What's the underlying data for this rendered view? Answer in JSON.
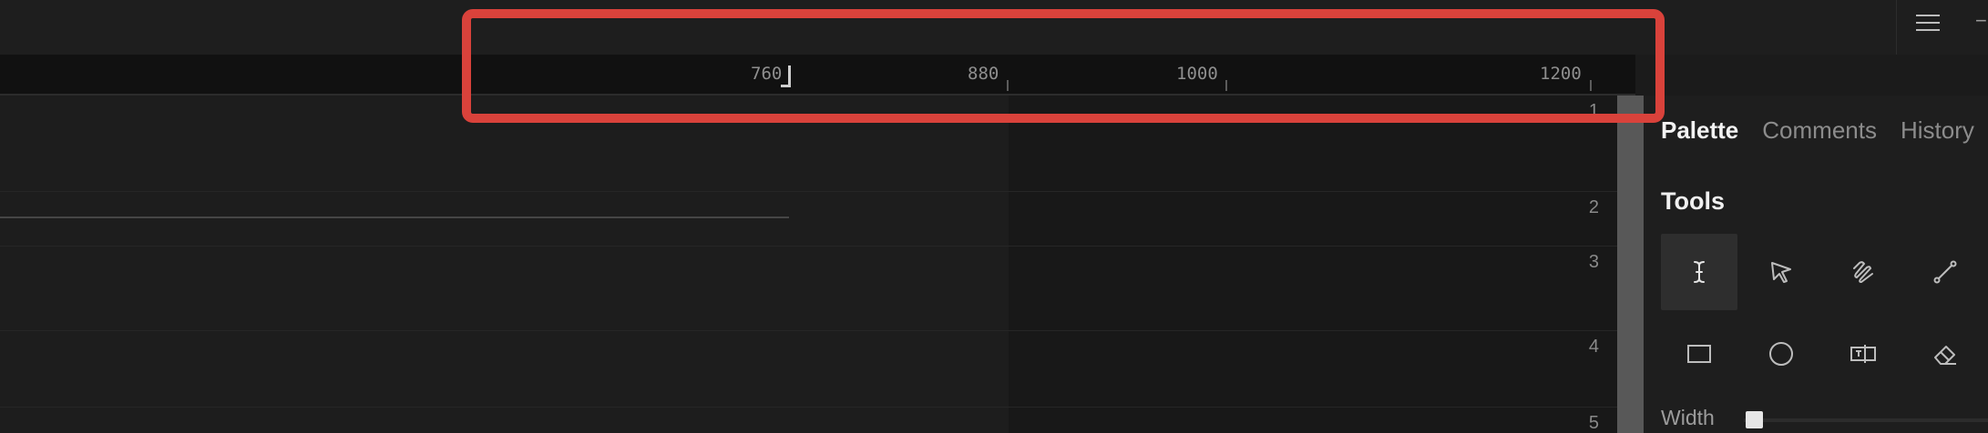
{
  "topbar": {
    "menu_icon": "hamburger-menu-icon",
    "edge_glyph": "−"
  },
  "ruler": {
    "labels": [
      "760",
      "880",
      "1000",
      "1200"
    ]
  },
  "canvas": {
    "row_numbers": [
      "1",
      "2",
      "3",
      "4",
      "5"
    ]
  },
  "panel": {
    "tabs": [
      "Palette",
      "Comments",
      "History"
    ],
    "active_tab": "Palette",
    "tools_title": "Tools",
    "tools": [
      {
        "name": "text-cursor-icon",
        "active": true
      },
      {
        "name": "pointer-icon",
        "active": false
      },
      {
        "name": "freehand-icon",
        "active": false
      },
      {
        "name": "line-icon",
        "active": false
      },
      {
        "name": "rectangle-icon",
        "active": false
      },
      {
        "name": "ellipse-icon",
        "active": false
      },
      {
        "name": "text-box-icon",
        "active": false
      },
      {
        "name": "eraser-icon",
        "active": false
      }
    ],
    "width_label": "Width"
  },
  "colors": {
    "annotation": "#d9423b",
    "background": "#1b1b1b"
  }
}
